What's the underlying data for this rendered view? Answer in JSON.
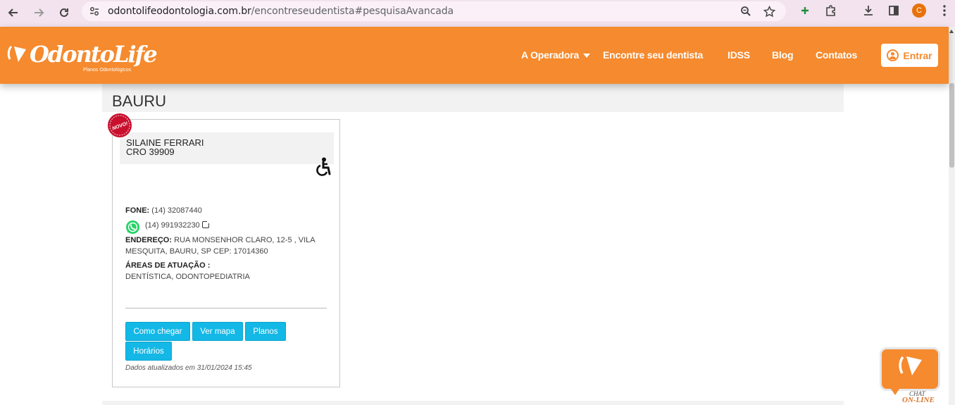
{
  "browser": {
    "url_host": "odontolifeodontologia.com.br",
    "url_path": "/encontreseudentista#pesquisaAvancada",
    "avatar_letter": "C",
    "icons": [
      "back-icon",
      "forward-icon",
      "reload-icon",
      "site-info-icon",
      "zoom-icon",
      "star-icon",
      "extension-plus-icon",
      "extensions-icon",
      "download-icon",
      "sidepanel-icon",
      "menu-dots-icon"
    ]
  },
  "header": {
    "logo_text": "OdontoLife",
    "logo_sub": "Planos Odontológicos",
    "menu": [
      {
        "label": "A Operadora"
      },
      {
        "label": "Encontre seu dentista"
      },
      {
        "label": "IDSS"
      },
      {
        "label": "Blog"
      },
      {
        "label": "Contatos"
      }
    ],
    "login_label": "Entrar",
    "brand_color": "#f58a2e"
  },
  "results": {
    "city": "BAURU",
    "card": {
      "badge": "NOVO!",
      "name": "SILAINE FERRARI",
      "cro": "CRO 39909",
      "phone_label": "FONE:",
      "phone": "(14) 32087440",
      "whatsapp": "(14) 991932230",
      "address_label": "ENDEREÇO:",
      "address_line1": "RUA MONSENHOR CLARO, 12-5 , VILA",
      "address_line2": "MESQUITA, BAURU, SP CEP: 17014360",
      "areas_label": "ÁREAS DE ATUAÇÃO :",
      "areas": "DENTÍSTICA, ODONTOPEDIATRIA",
      "buttons": {
        "directions": "Como chegar",
        "map": "Ver mapa",
        "plans": "Planos",
        "hours": "Horários"
      },
      "updated": "Dados atualizados em 31/01/2024 15:45",
      "button_color": "#13b8e6"
    }
  },
  "chat": {
    "line1": "CHAT",
    "line2": "ON-LINE"
  }
}
